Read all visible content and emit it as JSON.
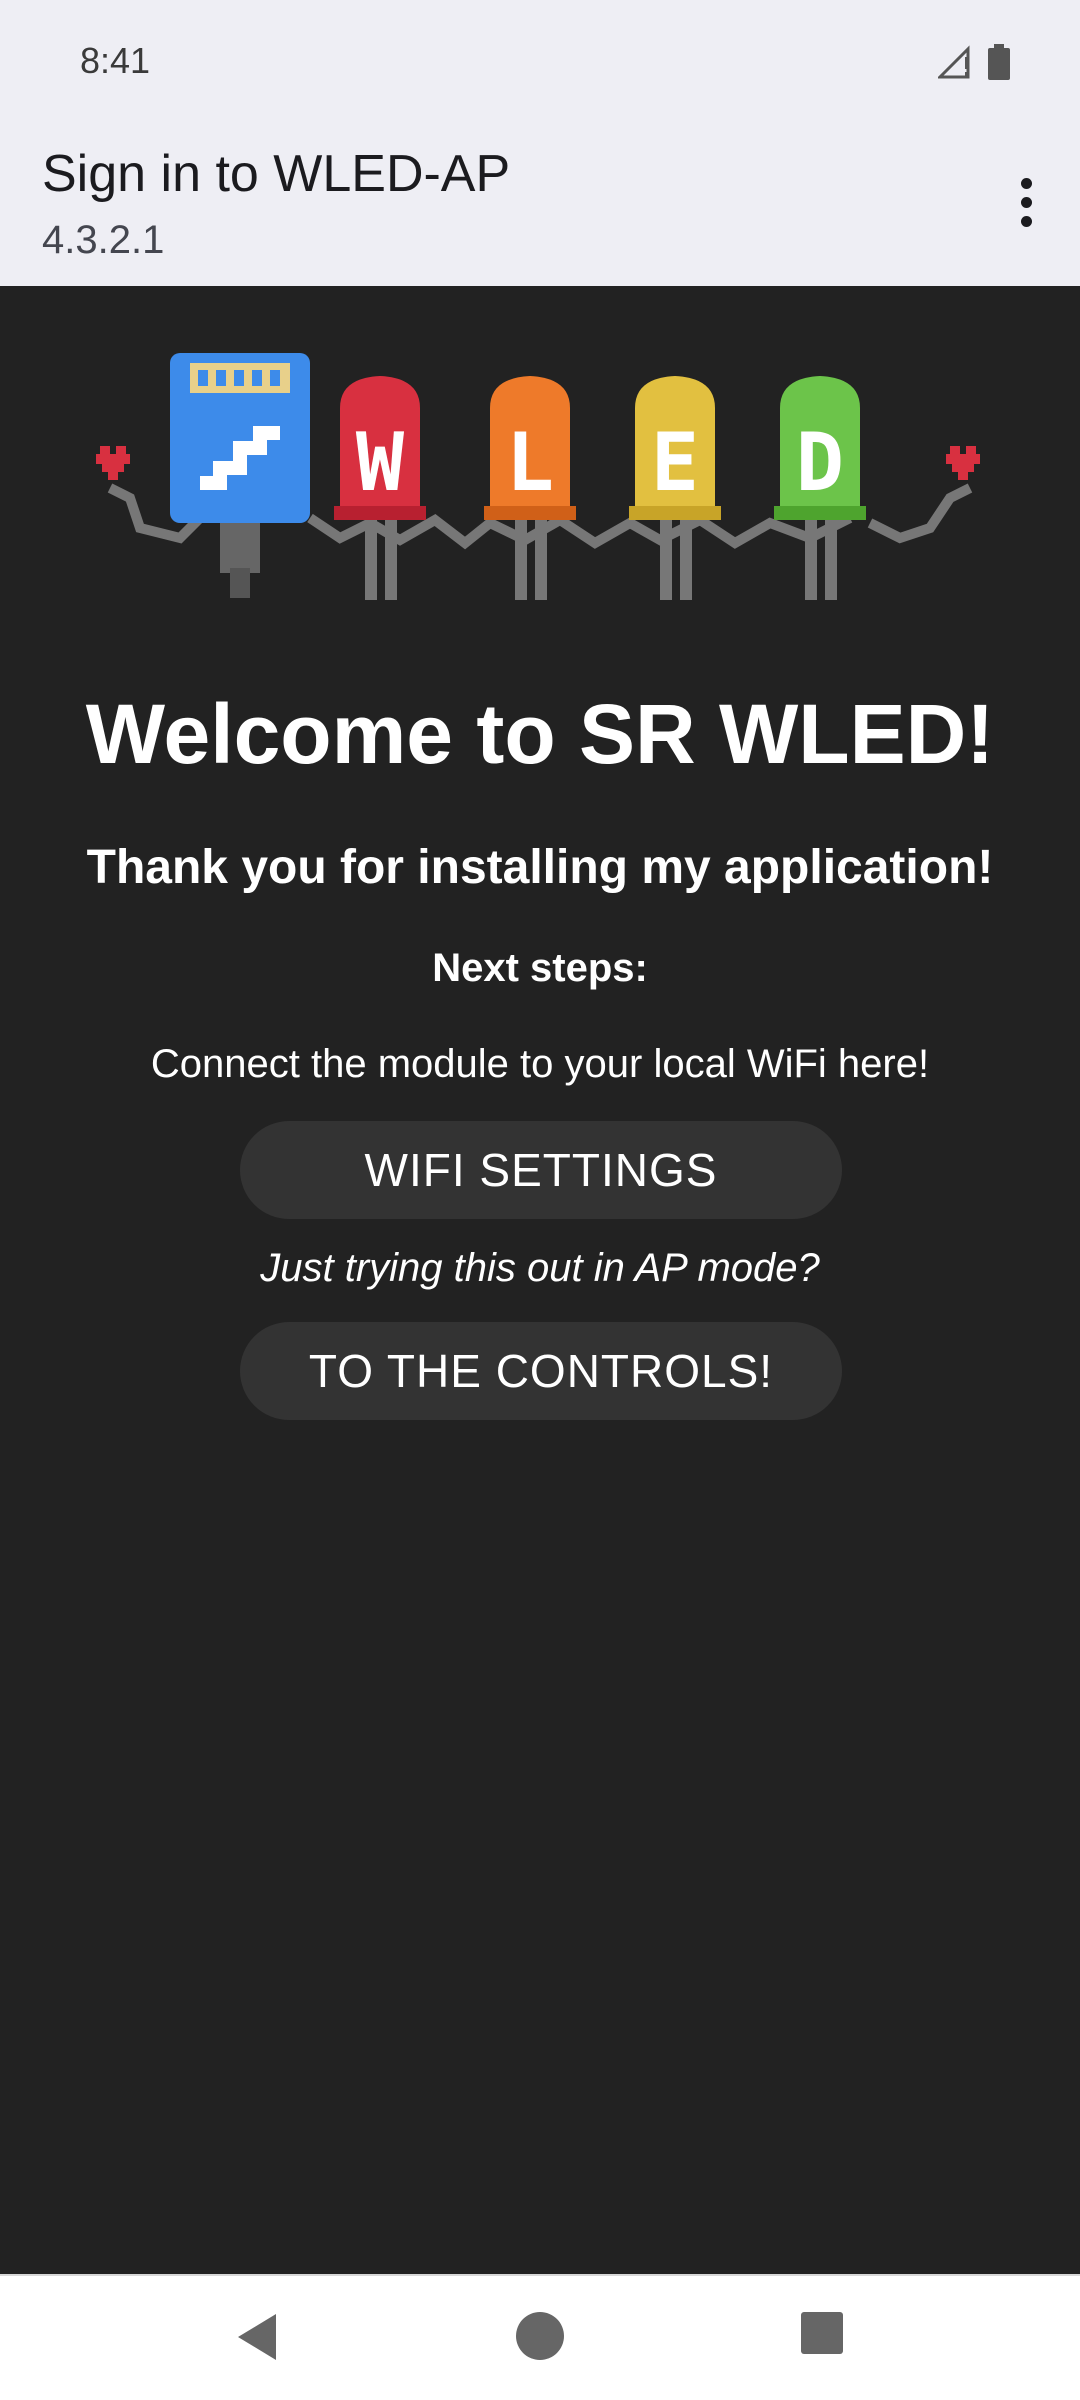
{
  "status_bar": {
    "time": "8:41",
    "icons": [
      "signal-no-data-icon",
      "battery-icon"
    ]
  },
  "app_bar": {
    "title": "Sign in to WLED-AP",
    "subtitle": "4.3.2.1",
    "menu_icon": "more-vert-icon"
  },
  "content": {
    "logo_text": "WLED",
    "welcome": "Welcome to SR WLED!",
    "thanks": "Thank you for installing my application!",
    "next_steps": "Next steps:",
    "connect_text": "Connect the module to your local WiFi here!",
    "wifi_button": "WIFI SETTINGS",
    "ap_text": "Just trying this out in AP mode?",
    "controls_button": "TO THE CONTROLS!"
  },
  "nav_bar": {
    "icons": [
      "back-icon",
      "home-icon",
      "recents-icon"
    ]
  },
  "colors": {
    "background": "#222222",
    "app_bar": "#EEEEF4",
    "button": "#333333",
    "led_blue": "#3D8BEA",
    "led_red": "#D83040",
    "led_orange": "#EE7A2A",
    "led_yellow": "#E2C040",
    "led_green": "#6CC44A",
    "heart": "#D83040"
  }
}
